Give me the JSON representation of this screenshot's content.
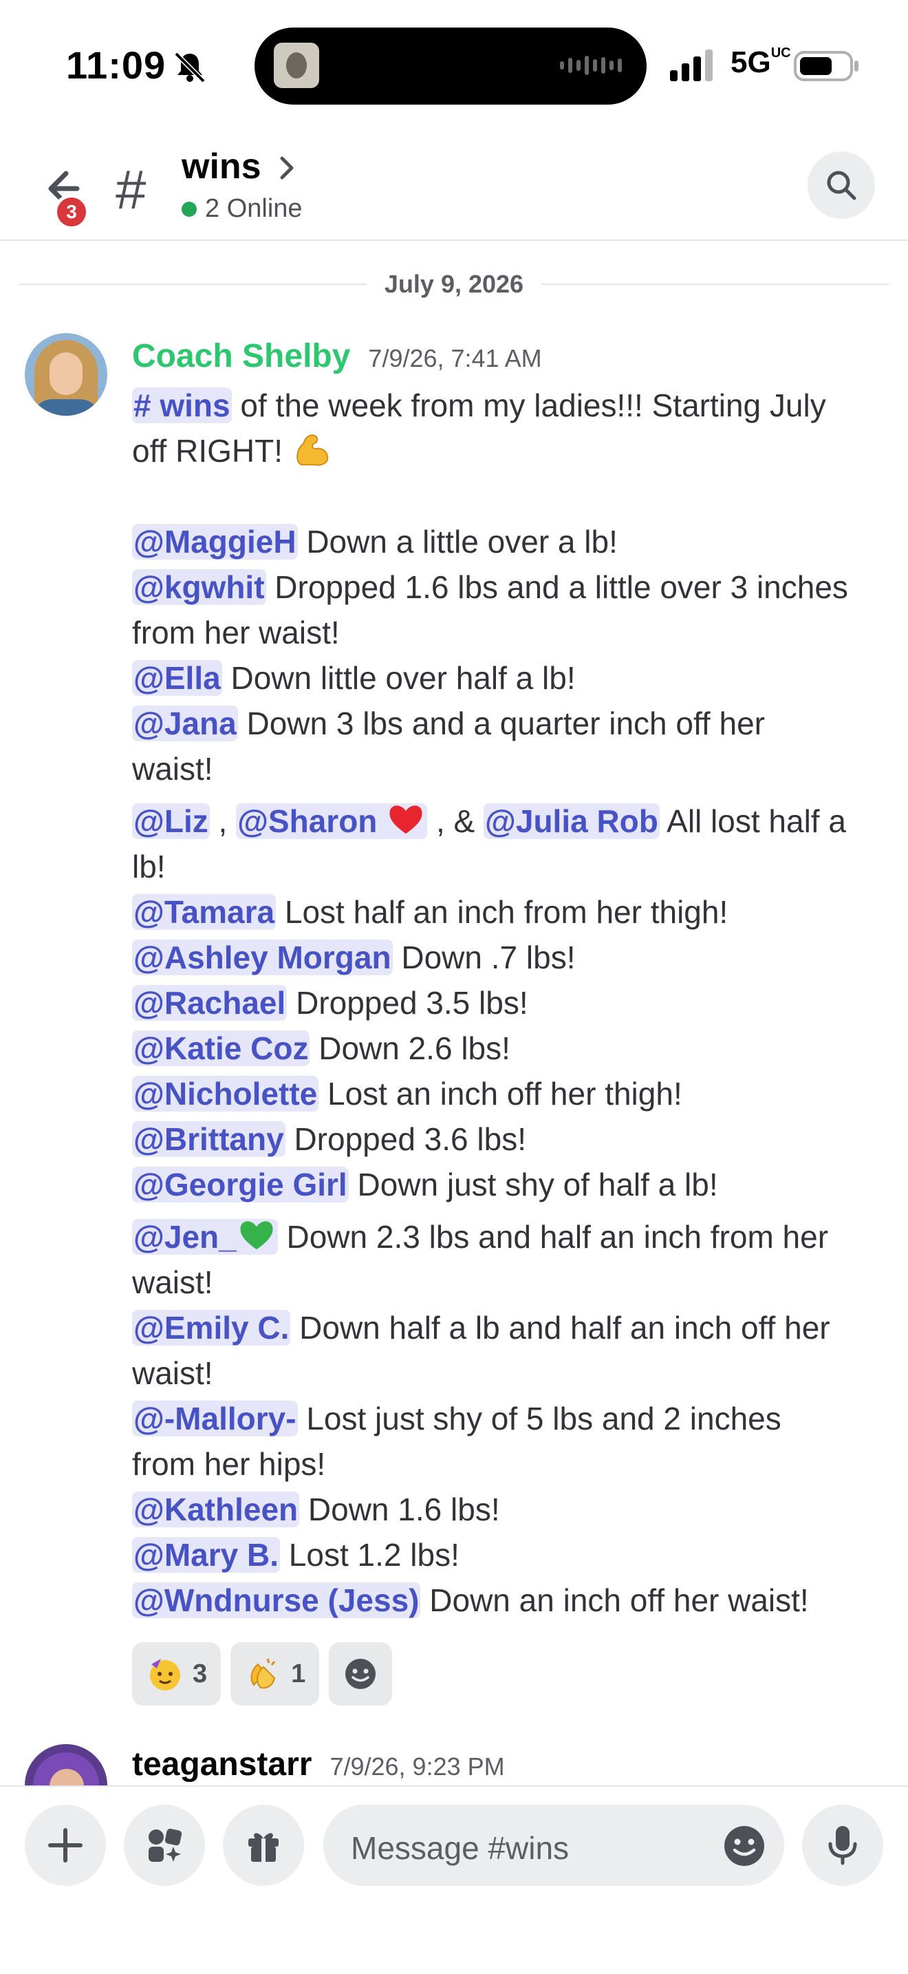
{
  "status_bar": {
    "time": "11:09",
    "network": "5G",
    "network_sup": "UC"
  },
  "header": {
    "back_badge": "3",
    "channel_name": "wins",
    "online_text": "2 Online"
  },
  "date_divider": "July 9, 2026",
  "messages": [
    {
      "author": "Coach Shelby",
      "timestamp": "7/9/26, 7:41 AM",
      "channel_link": "# wins",
      "intro_1": " of the week from my ladies!!! Starting July",
      "intro_2": "off RIGHT! ",
      "lines": {
        "m1": "@MaggieH",
        "t1": " Down a little over a lb!",
        "m2": "@kgwhit",
        "t2": " Dropped 1.6 lbs and a little over 3 inches",
        "t2b": "from her waist!",
        "m3": "@Ella",
        "t3": " Down little over half a lb!",
        "m4": "@Jana",
        "t4": " Down 3 lbs and a quarter inch off her",
        "t4b": "waist!",
        "m5a": "@Liz",
        "sep5a": " , ",
        "m5b": "@Sharon ",
        "sep5b": " , & ",
        "m5c": "@Julia Rob",
        "t5": " All lost half a",
        "t5b": "lb!",
        "m6": "@Tamara",
        "t6": " Lost half an inch from her thigh!",
        "m7": "@Ashley Morgan",
        "t7": " Down .7 lbs!",
        "m8": "@Rachael",
        "t8": " Dropped 3.5 lbs!",
        "m9": "@Katie Coz",
        "t9": " Down 2.6 lbs!",
        "m10": "@Nicholette",
        "t10": " Lost an inch off her thigh!",
        "m11": "@Brittany",
        "t11": " Dropped 3.6 lbs!",
        "m12": "@Georgie Girl",
        "t12": " Down just shy of half a lb!",
        "m13": "@Jen_",
        "t13": " Down 2.3 lbs and half an inch from her",
        "t13b": "waist!",
        "m14": "@Emily C.",
        "t14": " Down half a lb and half an inch off her",
        "t14b": "waist!",
        "m15": "@-Mallory-",
        "t15": " Lost just shy of 5 lbs and 2 inches",
        "t15b": "from her hips!",
        "m16": "@Kathleen",
        "t16": " Down 1.6 lbs!",
        "m17": "@Mary B.",
        "t17": " Lost 1.2 lbs!",
        "m18": "@Wndnurse (Jess)",
        "t18": " Down an inch off her waist!"
      },
      "reactions": [
        {
          "icon": "partying-face-icon",
          "count": "3"
        },
        {
          "icon": "clapping-hands-icon",
          "count": "1"
        }
      ]
    },
    {
      "author": "teaganstarr",
      "timestamp": "7/9/26, 9:23 PM"
    }
  ],
  "composer": {
    "placeholder": "Message #wins"
  },
  "colors": {
    "mention_bg": "#e6e6fa",
    "mention_text": "#4752c4",
    "coach_name": "#2dc770",
    "badge": "#da373c",
    "online": "#23a55a"
  }
}
